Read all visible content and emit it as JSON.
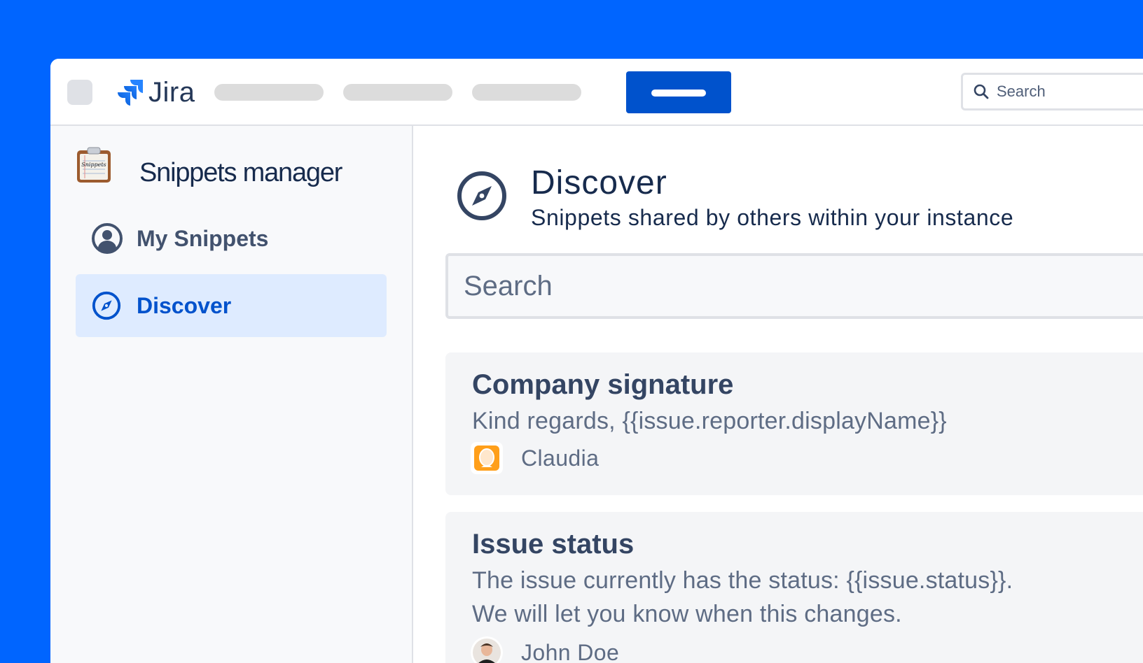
{
  "app": {
    "name": "Jira"
  },
  "topnav": {
    "search_placeholder": "Search",
    "create_button_label": ""
  },
  "sidebar": {
    "title": "Snippets manager",
    "app_icon_label": "Snippets",
    "items": [
      {
        "label": "My Snippets",
        "icon": "user-circle-icon",
        "selected": false
      },
      {
        "label": "Discover",
        "icon": "compass-icon",
        "selected": true
      }
    ]
  },
  "main": {
    "title": "Discover",
    "subtitle": "Snippets shared by others within your instance",
    "search_placeholder": "Search",
    "snippets": [
      {
        "title": "Company signature",
        "body_lines": [
          "Kind regards, {{issue.reporter.displayName}}"
        ],
        "author": "Claudia"
      },
      {
        "title": "Issue status",
        "body_lines": [
          "The issue currently has the status: {{issue.status}}.",
          "We will let you know when this changes."
        ],
        "author": "John Doe"
      }
    ]
  },
  "colors": {
    "background": "#0065FF",
    "primary": "#0052CC",
    "selected_bg": "#DEEBFF",
    "text_dark": "#172B4D",
    "text_muted": "#5E6C84"
  }
}
